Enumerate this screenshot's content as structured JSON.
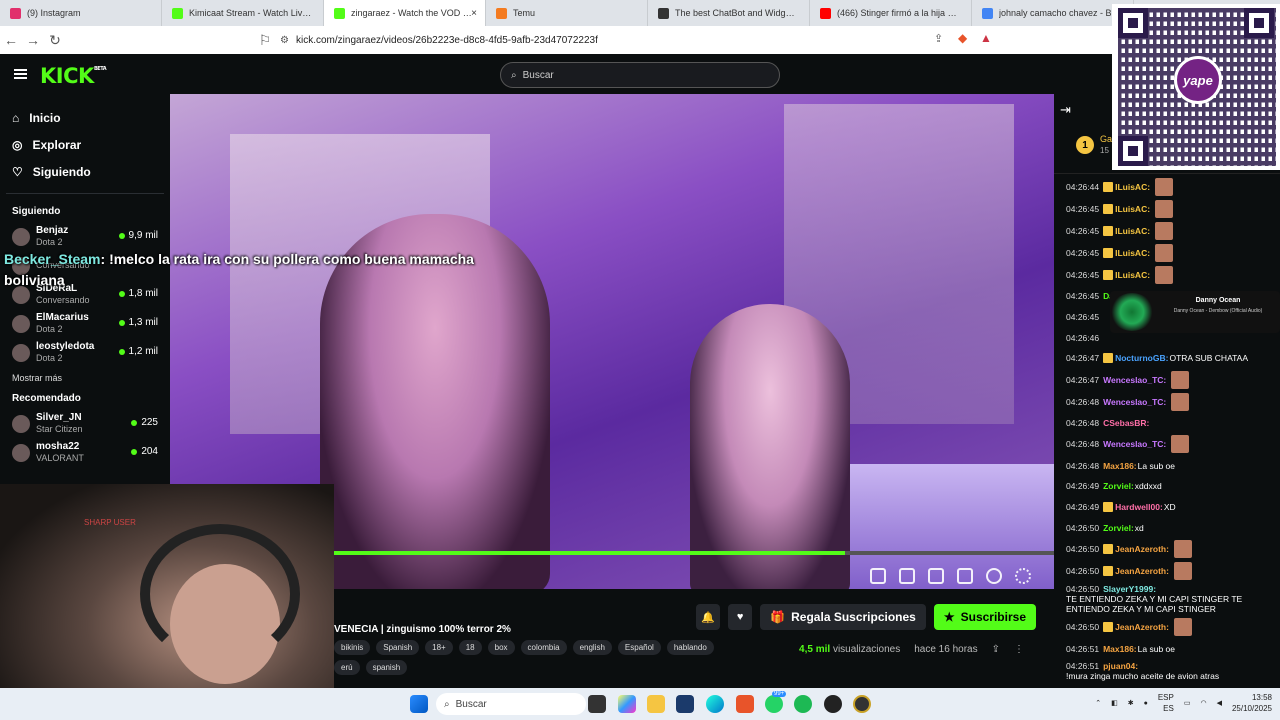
{
  "browser": {
    "tabs": [
      {
        "title": "(9) Instagram",
        "color": "#e1306c",
        "active": false
      },
      {
        "title": "Kimicaat Stream - Watch Live on Kick",
        "color": "#53fc18",
        "active": false
      },
      {
        "title": "zingaraez - Watch the VOD on Kick",
        "color": "#53fc18",
        "active": true
      },
      {
        "title": "Temu",
        "color": "#f47b20",
        "active": false
      },
      {
        "title": "The best ChatBot and Widgets for K",
        "color": "#333",
        "active": false
      },
      {
        "title": "(466) Stinger firmó a la hija de Vene",
        "color": "#ff0000",
        "active": false
      },
      {
        "title": "johnaly camacho chavez - Busc",
        "color": "#4285f4",
        "active": false
      }
    ],
    "url": "kick.com/zingaraez/videos/26b2223e-d8c8-4fd5-9afb-23d47072223f"
  },
  "header": {
    "logo": "KICK",
    "logo_badge": "BETA",
    "search_placeholder": "Buscar"
  },
  "sidebar": {
    "nav": [
      {
        "label": "Inicio",
        "icon": "home-icon"
      },
      {
        "label": "Explorar",
        "icon": "compass-icon"
      },
      {
        "label": "Siguiendo",
        "icon": "heart-icon"
      }
    ],
    "following_title": "Siguiendo",
    "following": [
      {
        "name": "Benjaz",
        "game": "Dota 2",
        "viewers": "9,9 mil"
      },
      {
        "name": "",
        "game": "Conversando",
        "viewers": ""
      },
      {
        "name": "SiDeRaL",
        "game": "Conversando",
        "viewers": "1,8 mil"
      },
      {
        "name": "ElMacarius",
        "game": "Dota 2",
        "viewers": "1,3 mil"
      },
      {
        "name": "leostyledota",
        "game": "Dota 2",
        "viewers": "1,2 mil"
      }
    ],
    "show_more": "Mostrar más",
    "recommended_title": "Recomendado",
    "recommended": [
      {
        "name": "Silver_JN",
        "game": "Star Citizen",
        "viewers": "225"
      },
      {
        "name": "mosha22",
        "game": "VALORANT",
        "viewers": "204"
      }
    ]
  },
  "overlay_chat": {
    "user": "Becker_Steam",
    "text": ": !melco la rata ira con su pollera como buena mamacha boliviana"
  },
  "webcam_label": "SHARP USER",
  "video": {
    "progress": 0.71,
    "title": "VENECIA | zinguismo 100% terror 2%",
    "tags": [
      "bikinis",
      "Spanish",
      "18+",
      "18",
      "box",
      "colombia",
      "english",
      "Español",
      "hablando"
    ],
    "tags2": [
      "erú",
      "spanish"
    ],
    "gift_label": "Regala Suscripciones",
    "subscribe_label": "Suscribirse",
    "views": "4,5 mil",
    "views_label": "visualizaciones",
    "time": "hace 16 horas"
  },
  "chat": {
    "gifter_rank": "1",
    "gifter_partial": "Ga",
    "gifter_count": "15",
    "messages": [
      {
        "time": "04:26:44",
        "user": "ILuisAC",
        "color": "#f5c542",
        "text": "",
        "emote": true,
        "badge": true
      },
      {
        "time": "04:26:45",
        "user": "ILuisAC",
        "color": "#f5c542",
        "text": "",
        "emote": true,
        "badge": true
      },
      {
        "time": "04:26:45",
        "user": "ILuisAC",
        "color": "#f5c542",
        "text": "",
        "emote": true,
        "badge": true
      },
      {
        "time": "04:26:45",
        "user": "ILuisAC",
        "color": "#f5c542",
        "text": "",
        "emote": true,
        "badge": true
      },
      {
        "time": "04:26:45",
        "user": "ILuisAC",
        "color": "#f5c542",
        "text": "",
        "emote": true,
        "badge": true
      },
      {
        "time": "04:26:45",
        "user": "Dasv03",
        "color": "#53fc18",
        "text": "Zinguitaaa ♥",
        "emote": false,
        "badge": false
      },
      {
        "time": "04:26:45",
        "user": "",
        "color": "#fff",
        "text": "",
        "emote": false,
        "badge": false
      },
      {
        "time": "04:26:46",
        "user": "",
        "color": "#fff",
        "text": "",
        "emote": false,
        "badge": false
      },
      {
        "time": "04:26:47",
        "user": "NocturnoGB",
        "color": "#4aa3ff",
        "text": "OTRA SUB CHATAA",
        "emote": false,
        "badge": true
      },
      {
        "time": "04:26:47",
        "user": "Wenceslao_TC",
        "color": "#c878ff",
        "text": "",
        "emote": true,
        "badge": false
      },
      {
        "time": "04:26:48",
        "user": "Wenceslao_TC",
        "color": "#c878ff",
        "text": "",
        "emote": true,
        "badge": false
      },
      {
        "time": "04:26:48",
        "user": "CSebasBR",
        "color": "#ff6fa8",
        "text": "",
        "emote": false,
        "badge": false
      },
      {
        "time": "04:26:48",
        "user": "Wenceslao_TC",
        "color": "#c878ff",
        "text": "",
        "emote": true,
        "badge": false
      },
      {
        "time": "04:26:48",
        "user": "Max186",
        "color": "#f5a442",
        "text": "La sub oe",
        "emote": false,
        "badge": false
      },
      {
        "time": "04:26:49",
        "user": "Zorviel",
        "color": "#53fc18",
        "text": "xddxxd",
        "emote": false,
        "badge": false
      },
      {
        "time": "04:26:49",
        "user": "Hardwell00",
        "color": "#ff6fa8",
        "text": "XD",
        "emote": false,
        "badge": true
      },
      {
        "time": "04:26:50",
        "user": "Zorviel",
        "color": "#53fc18",
        "text": "xd",
        "emote": false,
        "badge": false
      },
      {
        "time": "04:26:50",
        "user": "JeanAzeroth",
        "color": "#f5a442",
        "text": "",
        "emote": true,
        "badge": true
      },
      {
        "time": "04:26:50",
        "user": "JeanAzeroth",
        "color": "#f5a442",
        "text": "",
        "emote": true,
        "badge": true
      },
      {
        "time": "04:26:50",
        "user": "SlayerY1999",
        "color": "#7ee8e0",
        "text": "TE ENTIENDO ZEKA Y MI CAPI STINGER TE ENTIENDO ZEKA Y MI CAPI STINGER",
        "emote": false,
        "badge": false
      },
      {
        "time": "04:26:50",
        "user": "JeanAzeroth",
        "color": "#f5a442",
        "text": "",
        "emote": true,
        "badge": true
      },
      {
        "time": "04:26:51",
        "user": "Max186",
        "color": "#f5a442",
        "text": "La sub oe",
        "emote": false,
        "badge": false
      },
      {
        "time": "04:26:51",
        "user": "pjuan04",
        "color": "#f5a442",
        "text": "!mura zinga mucho aceite de avion atras",
        "emote": false,
        "badge": false
      }
    ]
  },
  "now_playing": {
    "title": "Danny Ocean",
    "subtitle": "Danny Ocean - Dembow (Official Audio)"
  },
  "qr": {
    "brand": "yape"
  },
  "taskbar": {
    "search": "Buscar",
    "lang": "ESP",
    "lang2": "ES",
    "time": "13:58",
    "date": "25/10/2025",
    "badge": "99+"
  }
}
